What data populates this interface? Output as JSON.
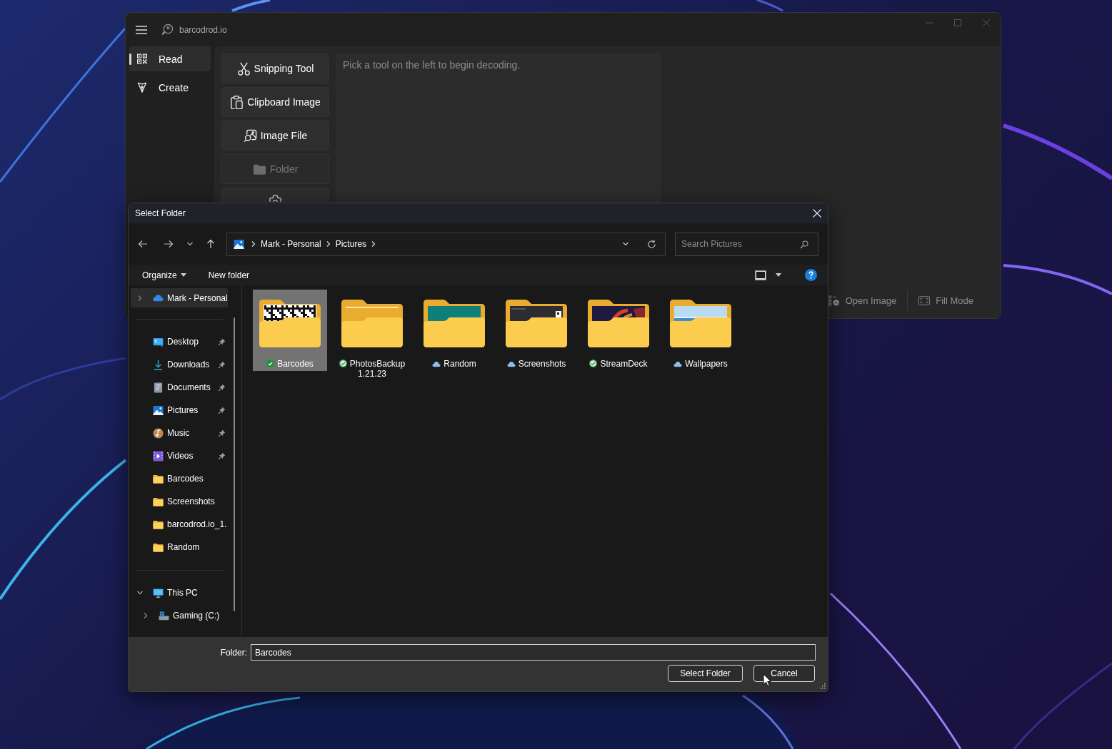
{
  "app_window": {
    "title": "barcodrod.io",
    "nav": [
      {
        "label": "Read",
        "kind": "read",
        "selected": true
      },
      {
        "label": "Create",
        "kind": "create",
        "selected": false
      }
    ],
    "tools": [
      {
        "label": "Snipping Tool",
        "kind": "snip",
        "disabled": false
      },
      {
        "label": "Clipboard Image",
        "kind": "clipboard",
        "disabled": false
      },
      {
        "label": "Image File",
        "kind": "file",
        "disabled": false
      },
      {
        "label": "Folder",
        "kind": "folder",
        "disabled": true
      },
      {
        "kind": "webcam",
        "disabled": false
      }
    ],
    "output": {
      "placeholder": "Pick a tool on the left to begin decoding."
    },
    "command_bar": [
      {
        "label": "Open Image",
        "kind": "open",
        "disabled": true
      },
      {
        "label": "Fill Mode",
        "kind": "fill",
        "disabled": true
      }
    ]
  },
  "dialog": {
    "title": "Select Folder",
    "breadcrumb": [
      "Mark - Personal",
      "Pictures"
    ],
    "search": {
      "placeholder": "Search Pictures"
    },
    "toolbar": {
      "organize": "Organize",
      "new_folder": "New folder"
    },
    "nav_pane": {
      "accounts": [
        {
          "label": "Mark - Personal",
          "kind": "cloud",
          "selected": true,
          "expanded": false
        }
      ],
      "quick_access": [
        {
          "label": "Desktop",
          "kind": "desktop",
          "pinned": true,
          "selected": false
        },
        {
          "label": "Downloads",
          "kind": "downloads",
          "pinned": true,
          "selected": false
        },
        {
          "label": "Documents",
          "kind": "documents",
          "pinned": true,
          "selected": false
        },
        {
          "label": "Pictures",
          "kind": "pictures",
          "pinned": true,
          "selected": false
        },
        {
          "label": "Music",
          "kind": "music",
          "pinned": true,
          "selected": false
        },
        {
          "label": "Videos",
          "kind": "videos",
          "pinned": true,
          "selected": false
        },
        {
          "label": "Barcodes",
          "kind": "folder",
          "pinned": false,
          "selected": false
        },
        {
          "label": "Screenshots",
          "kind": "folder",
          "pinned": false,
          "selected": false
        },
        {
          "label": "barcodrod.io_1.",
          "kind": "folder",
          "pinned": false,
          "selected": false
        },
        {
          "label": "Random",
          "kind": "folder",
          "pinned": false,
          "selected": false
        }
      ],
      "devices": [
        {
          "label": "This PC",
          "kind": "pc",
          "selected": false,
          "expanded": true,
          "children": [
            {
              "label": "Gaming (C:)",
              "kind": "drive",
              "selected": false,
              "expanded": false
            }
          ]
        }
      ]
    },
    "folders": [
      {
        "name": "Barcodes",
        "kind": "qr",
        "downloaded": true,
        "always_keep": true,
        "selected": true
      },
      {
        "name": "PhotosBackup 1.21.23",
        "kind": "blank",
        "downloaded": true,
        "always_keep": false,
        "selected": false
      },
      {
        "name": "Random",
        "kind": "teal",
        "downloaded": false,
        "always_keep": false,
        "selected": false
      },
      {
        "name": "Screenshots",
        "kind": "screen",
        "downloaded": false,
        "always_keep": false,
        "selected": false
      },
      {
        "name": "StreamDeck",
        "kind": "art",
        "downloaded": true,
        "always_keep": false,
        "selected": false
      },
      {
        "name": "Wallpapers",
        "kind": "sky",
        "downloaded": false,
        "always_keep": false,
        "selected": false
      }
    ],
    "folder_field": {
      "label": "Folder:",
      "value": "Barcodes"
    },
    "buttons": [
      "Select Folder",
      "Cancel"
    ]
  }
}
